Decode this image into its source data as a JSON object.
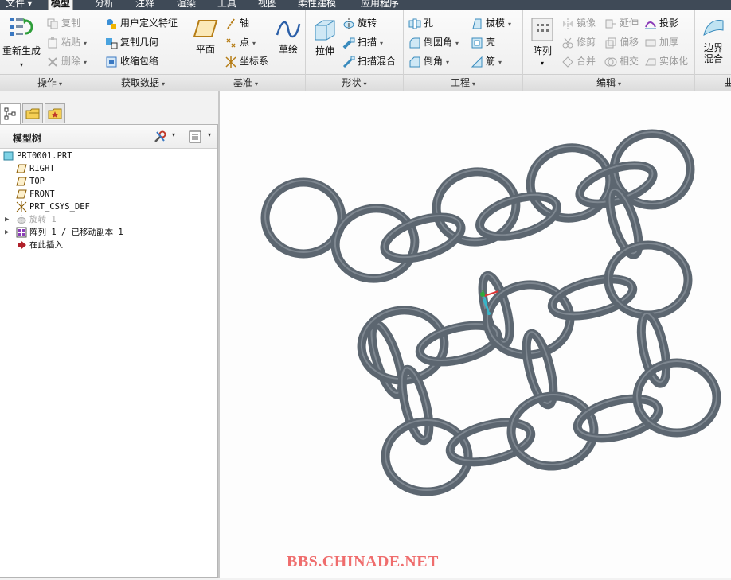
{
  "menubar": {
    "tabs": [
      "文件",
      "模型",
      "分析",
      "注释",
      "渲染",
      "工具",
      "视图",
      "柔性建模",
      "应用程序"
    ],
    "active": "模型"
  },
  "ribbon": {
    "groups": {
      "operations": "操作",
      "get_data": "获取数据",
      "datum": "基准",
      "shapes": "形状",
      "engineering": "工程",
      "editing": "编辑",
      "surfaces": "曲"
    },
    "buttons": {
      "regenerate": "重新生成",
      "copy": "复制",
      "paste": "粘贴",
      "delete": "删除",
      "udf": "用户定义特征",
      "copy_geometry": "复制几何",
      "shrinkwrap": "收缩包络",
      "plane": "平面",
      "axis": "轴",
      "point": "点",
      "csys": "坐标系",
      "sketch": "草绘",
      "extrude": "拉伸",
      "revolve": "旋转",
      "sweep": "扫描",
      "swept_blend": "扫描混合",
      "hole": "孔",
      "round": "倒圆角",
      "chamfer": "倒角",
      "draft": "拔模",
      "shell": "壳",
      "rib": "筋",
      "pattern": "阵列",
      "mirror": "镜像",
      "trim": "修剪",
      "merge": "合并",
      "extend": "延伸",
      "offset": "偏移",
      "intersect": "相交",
      "project": "投影",
      "thicken": "加厚",
      "solidify": "实体化",
      "boundary_blend_1": "边界",
      "boundary_blend_2": "混合"
    }
  },
  "panel": {
    "title": "模型树",
    "tree": [
      {
        "label": "PRT0001.PRT",
        "icon": "part-icon",
        "dim": false
      },
      {
        "label": "RIGHT",
        "icon": "datum-plane-icon",
        "dim": false
      },
      {
        "label": "TOP",
        "icon": "datum-plane-icon",
        "dim": false
      },
      {
        "label": "FRONT",
        "icon": "datum-plane-icon",
        "dim": false
      },
      {
        "label": "PRT_CSYS_DEF",
        "icon": "csys-icon",
        "dim": false
      },
      {
        "label": "旋转 1",
        "icon": "revolve-icon",
        "dim": true
      },
      {
        "label": "阵列 1 / 已移动副本 1",
        "icon": "pattern-icon",
        "dim": false
      },
      {
        "label": "在此插入",
        "icon": "insert-here-icon",
        "dim": false
      }
    ]
  },
  "viewport": {
    "model": "chain-mail-rings",
    "ring_color": "#5c6670",
    "watermark": "BBS.CHINADE.NET"
  }
}
